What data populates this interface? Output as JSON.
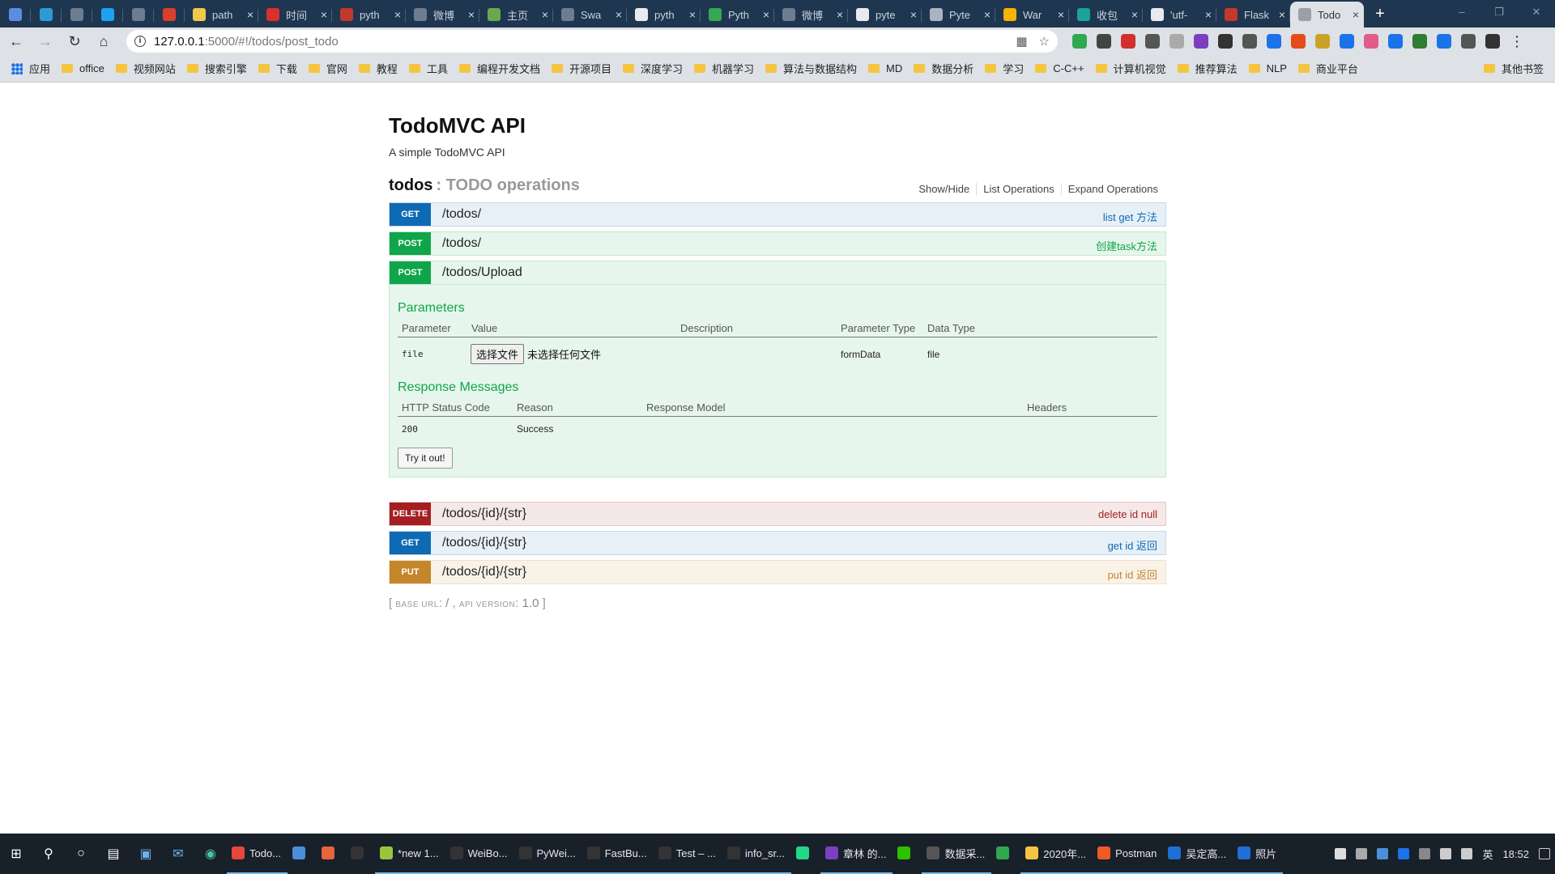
{
  "browser": {
    "tabs": [
      {
        "title": "",
        "color": "#5b8de0"
      },
      {
        "title": "",
        "color": "#2c9ad8"
      },
      {
        "title": "",
        "color": "#6d7d8f"
      },
      {
        "title": "",
        "color": "#1da1f2"
      },
      {
        "title": "",
        "color": "#6d7d8f"
      },
      {
        "title": "",
        "color": "#d93f2b"
      },
      {
        "title": "path",
        "color": "#f2c94c"
      },
      {
        "title": "时间",
        "color": "#d9302e"
      },
      {
        "title": "pyth",
        "color": "#c0392b"
      },
      {
        "title": "微博",
        "color": "#6d7d8f"
      },
      {
        "title": "主页",
        "color": "#6aa84f"
      },
      {
        "title": "Swa",
        "color": "#6d7d8f"
      },
      {
        "title": "pyth",
        "color": "#e8eaed"
      },
      {
        "title": "Pyth",
        "color": "#34a853"
      },
      {
        "title": "微博",
        "color": "#6d7d8f"
      },
      {
        "title": "pyte",
        "color": "#e8eaed"
      },
      {
        "title": "Pyte",
        "color": "#aab4c0"
      },
      {
        "title": "War",
        "color": "#f4b400"
      },
      {
        "title": "收包",
        "color": "#1aa39b"
      },
      {
        "title": "'utf-",
        "color": "#e8eaed"
      },
      {
        "title": "Flask",
        "color": "#c0392b"
      },
      {
        "title": "Todo",
        "color": "#9aa0a6",
        "active": true
      }
    ],
    "url_host": "127.0.0.1",
    "url_path": ":5000/#!/todos/post_todo",
    "bookmarks": [
      "应用",
      "office",
      "视频网站",
      "搜索引擎",
      "下载",
      "官网",
      "教程",
      "工具",
      "编程开发文档",
      "开源项目",
      "深度学习",
      "机器学习",
      "算法与数据结构",
      "MD",
      "数据分析",
      "学习",
      "C-C++",
      "计算机视觉",
      "推荐算法",
      "NLP",
      "商业平台"
    ],
    "bookmarks_right": "其他书签",
    "extension_colors": [
      "#2fa84f",
      "#444",
      "#d32f2f",
      "#555",
      "#aaa",
      "#7b3fbf",
      "#333",
      "#555",
      "#1a73e8",
      "#e64a19",
      "#c9a227",
      "#1a73e8",
      "#e25c8a",
      "#1a73e8",
      "#2e7d32",
      "#1a73e8",
      "#555",
      "#333"
    ]
  },
  "api": {
    "title": "TodoMVC API",
    "description": "A simple TodoMVC API",
    "resource_name": "todos",
    "resource_desc": ": TODO operations",
    "links": [
      "Show/Hide",
      "List Operations",
      "Expand Operations"
    ],
    "ops_top": [
      {
        "verb": "GET",
        "kind": "get",
        "path": "/todos/",
        "summary": "list get 方法"
      },
      {
        "verb": "POST",
        "kind": "post",
        "path": "/todos/",
        "summary": "创建task方法"
      }
    ],
    "expanded": {
      "verb": "POST",
      "path": "/todos/Upload",
      "params_title": "Parameters",
      "param_headers": [
        "Parameter",
        "Value",
        "Description",
        "Parameter Type",
        "Data Type"
      ],
      "param": {
        "name": "file",
        "button": "选择文件",
        "file_text": "未选择任何文件",
        "description": "",
        "param_type": "formData",
        "data_type": "file"
      },
      "responses_title": "Response Messages",
      "response_headers": [
        "HTTP Status Code",
        "Reason",
        "Response Model",
        "Headers"
      ],
      "response": {
        "code": "200",
        "reason": "Success",
        "model": "",
        "headers": ""
      },
      "try_label": "Try it out!"
    },
    "ops_bottom": [
      {
        "verb": "DELETE",
        "kind": "del",
        "path": "/todos/{id}/{str}",
        "summary": "delete id null"
      },
      {
        "verb": "GET",
        "kind": "get",
        "path": "/todos/{id}/{str}",
        "summary": "get id 返回"
      },
      {
        "verb": "PUT",
        "kind": "put",
        "path": "/todos/{id}/{str}",
        "summary": "put id 返回"
      }
    ],
    "footer": {
      "base_label": "base url",
      "base_value": "/",
      "version_label": "api version",
      "version_value": "1.0"
    }
  },
  "taskbar": {
    "apps": [
      {
        "label": "Todo...",
        "color": "#e8453c",
        "active": true
      },
      {
        "label": "",
        "color": "#4a90d9"
      },
      {
        "label": "",
        "color": "#e8643c"
      },
      {
        "label": "",
        "color": "#333"
      },
      {
        "label": "*new 1...",
        "color": "#9bc53d",
        "active": true
      },
      {
        "label": "WeiBo...",
        "color": "#333",
        "active": true
      },
      {
        "label": "PyWei...",
        "color": "#333",
        "active": true
      },
      {
        "label": "FastBu...",
        "color": "#333",
        "active": true
      },
      {
        "label": "Test – ...",
        "color": "#333",
        "active": true
      },
      {
        "label": "info_sr...",
        "color": "#333",
        "active": true
      },
      {
        "label": "",
        "color": "#21d789"
      },
      {
        "label": "章林 的...",
        "color": "#7b3fbf",
        "active": true
      },
      {
        "label": "",
        "color": "#2dc100"
      },
      {
        "label": "数据采...",
        "color": "#555",
        "active": true
      },
      {
        "label": "",
        "color": "#2fa84f"
      },
      {
        "label": "2020年...",
        "color": "#f5c542",
        "active": true
      },
      {
        "label": "Postman",
        "color": "#ef5b25",
        "active": true
      },
      {
        "label": "吴定高...",
        "color": "#1f6fd6",
        "active": true
      },
      {
        "label": "照片",
        "color": "#1f6fd6",
        "active": true
      }
    ],
    "ime": "英",
    "time": "18:52"
  }
}
